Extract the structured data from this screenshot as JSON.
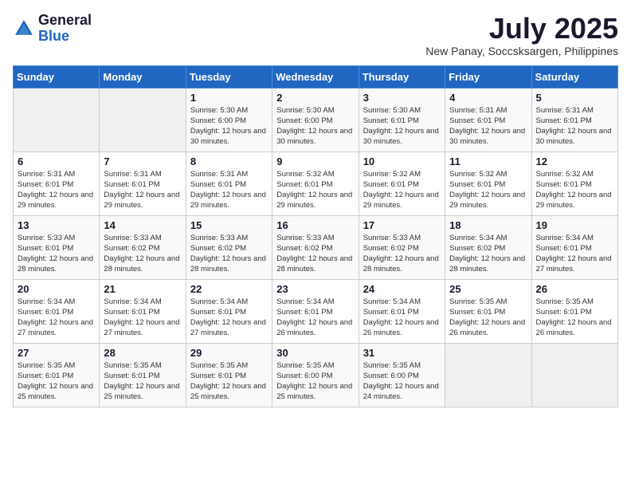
{
  "header": {
    "logo_general": "General",
    "logo_blue": "Blue",
    "month_year": "July 2025",
    "location": "New Panay, Soccsksargen, Philippines"
  },
  "days_of_week": [
    "Sunday",
    "Monday",
    "Tuesday",
    "Wednesday",
    "Thursday",
    "Friday",
    "Saturday"
  ],
  "weeks": [
    [
      {
        "day": "",
        "sunrise": "",
        "sunset": "",
        "daylight": ""
      },
      {
        "day": "",
        "sunrise": "",
        "sunset": "",
        "daylight": ""
      },
      {
        "day": "1",
        "sunrise": "Sunrise: 5:30 AM",
        "sunset": "Sunset: 6:00 PM",
        "daylight": "Daylight: 12 hours and 30 minutes."
      },
      {
        "day": "2",
        "sunrise": "Sunrise: 5:30 AM",
        "sunset": "Sunset: 6:00 PM",
        "daylight": "Daylight: 12 hours and 30 minutes."
      },
      {
        "day": "3",
        "sunrise": "Sunrise: 5:30 AM",
        "sunset": "Sunset: 6:01 PM",
        "daylight": "Daylight: 12 hours and 30 minutes."
      },
      {
        "day": "4",
        "sunrise": "Sunrise: 5:31 AM",
        "sunset": "Sunset: 6:01 PM",
        "daylight": "Daylight: 12 hours and 30 minutes."
      },
      {
        "day": "5",
        "sunrise": "Sunrise: 5:31 AM",
        "sunset": "Sunset: 6:01 PM",
        "daylight": "Daylight: 12 hours and 30 minutes."
      }
    ],
    [
      {
        "day": "6",
        "sunrise": "Sunrise: 5:31 AM",
        "sunset": "Sunset: 6:01 PM",
        "daylight": "Daylight: 12 hours and 29 minutes."
      },
      {
        "day": "7",
        "sunrise": "Sunrise: 5:31 AM",
        "sunset": "Sunset: 6:01 PM",
        "daylight": "Daylight: 12 hours and 29 minutes."
      },
      {
        "day": "8",
        "sunrise": "Sunrise: 5:31 AM",
        "sunset": "Sunset: 6:01 PM",
        "daylight": "Daylight: 12 hours and 29 minutes."
      },
      {
        "day": "9",
        "sunrise": "Sunrise: 5:32 AM",
        "sunset": "Sunset: 6:01 PM",
        "daylight": "Daylight: 12 hours and 29 minutes."
      },
      {
        "day": "10",
        "sunrise": "Sunrise: 5:32 AM",
        "sunset": "Sunset: 6:01 PM",
        "daylight": "Daylight: 12 hours and 29 minutes."
      },
      {
        "day": "11",
        "sunrise": "Sunrise: 5:32 AM",
        "sunset": "Sunset: 6:01 PM",
        "daylight": "Daylight: 12 hours and 29 minutes."
      },
      {
        "day": "12",
        "sunrise": "Sunrise: 5:32 AM",
        "sunset": "Sunset: 6:01 PM",
        "daylight": "Daylight: 12 hours and 29 minutes."
      }
    ],
    [
      {
        "day": "13",
        "sunrise": "Sunrise: 5:33 AM",
        "sunset": "Sunset: 6:01 PM",
        "daylight": "Daylight: 12 hours and 28 minutes."
      },
      {
        "day": "14",
        "sunrise": "Sunrise: 5:33 AM",
        "sunset": "Sunset: 6:02 PM",
        "daylight": "Daylight: 12 hours and 28 minutes."
      },
      {
        "day": "15",
        "sunrise": "Sunrise: 5:33 AM",
        "sunset": "Sunset: 6:02 PM",
        "daylight": "Daylight: 12 hours and 28 minutes."
      },
      {
        "day": "16",
        "sunrise": "Sunrise: 5:33 AM",
        "sunset": "Sunset: 6:02 PM",
        "daylight": "Daylight: 12 hours and 28 minutes."
      },
      {
        "day": "17",
        "sunrise": "Sunrise: 5:33 AM",
        "sunset": "Sunset: 6:02 PM",
        "daylight": "Daylight: 12 hours and 28 minutes."
      },
      {
        "day": "18",
        "sunrise": "Sunrise: 5:34 AM",
        "sunset": "Sunset: 6:02 PM",
        "daylight": "Daylight: 12 hours and 28 minutes."
      },
      {
        "day": "19",
        "sunrise": "Sunrise: 5:34 AM",
        "sunset": "Sunset: 6:01 PM",
        "daylight": "Daylight: 12 hours and 27 minutes."
      }
    ],
    [
      {
        "day": "20",
        "sunrise": "Sunrise: 5:34 AM",
        "sunset": "Sunset: 6:01 PM",
        "daylight": "Daylight: 12 hours and 27 minutes."
      },
      {
        "day": "21",
        "sunrise": "Sunrise: 5:34 AM",
        "sunset": "Sunset: 6:01 PM",
        "daylight": "Daylight: 12 hours and 27 minutes."
      },
      {
        "day": "22",
        "sunrise": "Sunrise: 5:34 AM",
        "sunset": "Sunset: 6:01 PM",
        "daylight": "Daylight: 12 hours and 27 minutes."
      },
      {
        "day": "23",
        "sunrise": "Sunrise: 5:34 AM",
        "sunset": "Sunset: 6:01 PM",
        "daylight": "Daylight: 12 hours and 26 minutes."
      },
      {
        "day": "24",
        "sunrise": "Sunrise: 5:34 AM",
        "sunset": "Sunset: 6:01 PM",
        "daylight": "Daylight: 12 hours and 26 minutes."
      },
      {
        "day": "25",
        "sunrise": "Sunrise: 5:35 AM",
        "sunset": "Sunset: 6:01 PM",
        "daylight": "Daylight: 12 hours and 26 minutes."
      },
      {
        "day": "26",
        "sunrise": "Sunrise: 5:35 AM",
        "sunset": "Sunset: 6:01 PM",
        "daylight": "Daylight: 12 hours and 26 minutes."
      }
    ],
    [
      {
        "day": "27",
        "sunrise": "Sunrise: 5:35 AM",
        "sunset": "Sunset: 6:01 PM",
        "daylight": "Daylight: 12 hours and 25 minutes."
      },
      {
        "day": "28",
        "sunrise": "Sunrise: 5:35 AM",
        "sunset": "Sunset: 6:01 PM",
        "daylight": "Daylight: 12 hours and 25 minutes."
      },
      {
        "day": "29",
        "sunrise": "Sunrise: 5:35 AM",
        "sunset": "Sunset: 6:01 PM",
        "daylight": "Daylight: 12 hours and 25 minutes."
      },
      {
        "day": "30",
        "sunrise": "Sunrise: 5:35 AM",
        "sunset": "Sunset: 6:00 PM",
        "daylight": "Daylight: 12 hours and 25 minutes."
      },
      {
        "day": "31",
        "sunrise": "Sunrise: 5:35 AM",
        "sunset": "Sunset: 6:00 PM",
        "daylight": "Daylight: 12 hours and 24 minutes."
      },
      {
        "day": "",
        "sunrise": "",
        "sunset": "",
        "daylight": ""
      },
      {
        "day": "",
        "sunrise": "",
        "sunset": "",
        "daylight": ""
      }
    ]
  ]
}
